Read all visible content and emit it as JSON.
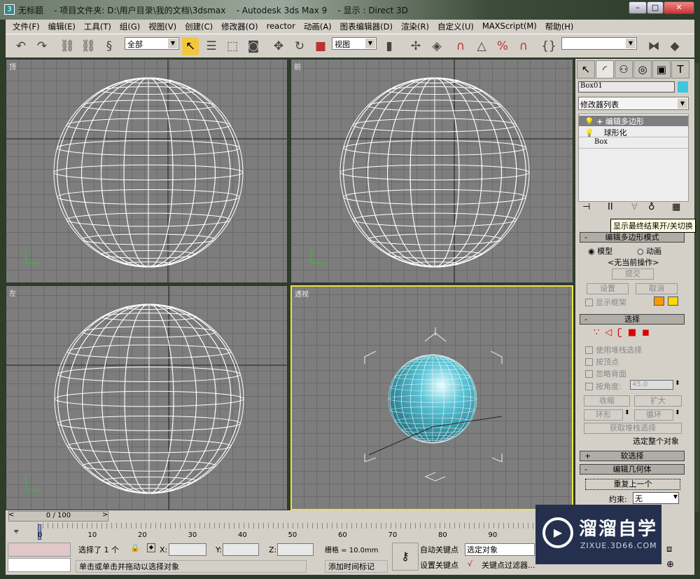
{
  "window": {
    "title": "无标题",
    "project": "- 项目文件夹: D:\\用户目录\\我的文档\\3dsmax",
    "app": "- Autodesk 3ds Max 9",
    "display": "- 显示 : Direct 3D"
  },
  "menu": [
    "文件(F)",
    "编辑(E)",
    "工具(T)",
    "组(G)",
    "视图(V)",
    "创建(C)",
    "修改器(O)",
    "reactor",
    "动画(A)",
    "图表编辑器(D)",
    "渲染(R)",
    "自定义(U)",
    "MAXScript(M)",
    "帮助(H)"
  ],
  "toolbar": {
    "selection_filter": "全部",
    "reference_coord": "视图",
    "named_selection": ""
  },
  "viewports": [
    {
      "label": "顶"
    },
    {
      "label": "前"
    },
    {
      "label": "左"
    },
    {
      "label": "透视",
      "active": true
    }
  ],
  "panel": {
    "object_name": "Box01",
    "object_color": "#3ec6e0",
    "modifier_list": "修改器列表",
    "stack": [
      "编辑多边形",
      "球形化",
      "Box"
    ],
    "tooltip": "显示最终结果开/关切换",
    "edit_poly_mode": {
      "title": "编辑多边形模式",
      "model": "模型",
      "animate": "动画",
      "no_op": "<无当前操作>",
      "commit": "提交",
      "settings": "设置",
      "cancel": "取消",
      "show_cage": "显示框架",
      "cage_colors": [
        "#ff9900",
        "#ffd800"
      ]
    },
    "selection": {
      "title": "选择",
      "use_stack": "使用堆栈选择",
      "by_vertex": "按顶点",
      "ignore_backface": "忽略背面",
      "by_angle": "按角度:",
      "angle": "45.0",
      "shrink": "收缩",
      "grow": "扩大",
      "ring": "环形",
      "loop": "循环",
      "get_stack": "获取堆栈选择",
      "status": "选定整个对象"
    },
    "soft_selection": "软选择",
    "edit_geometry": {
      "title": "编辑几何体",
      "repeat_last": "重复上一个",
      "constraint_label": "约束:",
      "constraint": "无"
    }
  },
  "timeline": {
    "frame": "0 / 100",
    "ticks": [
      "0",
      "10",
      "20",
      "30",
      "40",
      "50",
      "60",
      "70",
      "80",
      "90",
      "100"
    ]
  },
  "status": {
    "selected": "选择了 1 个",
    "x_label": "X:",
    "y_label": "Y:",
    "z_label": "Z:",
    "grid": "栅格 = 10.0mm",
    "auto_key": "自动关键点",
    "set_key": "设置关键点",
    "key_mode": "选定对象",
    "key_filters": "关键点过滤器...",
    "prompt": "单击或单击并拖动以选择对象",
    "add_time_tag": "添加时间标记"
  },
  "watermark": {
    "name": "溜溜自学",
    "url": "ZIXUE.3D66.COM"
  }
}
